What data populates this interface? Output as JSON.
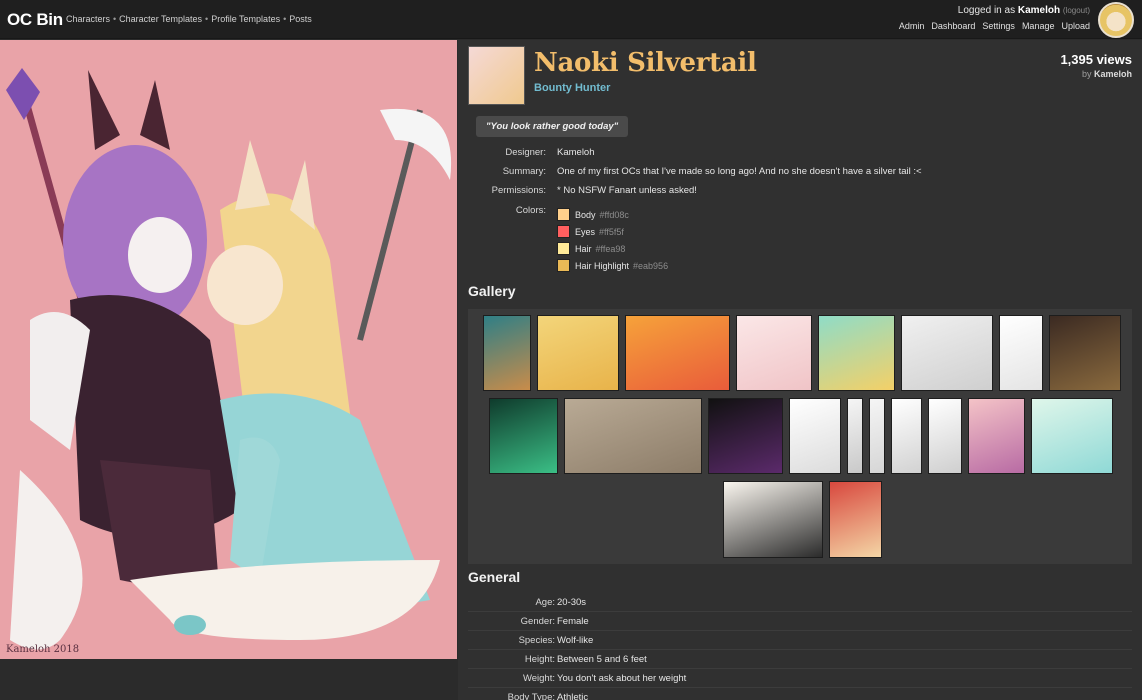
{
  "app": {
    "logo": "OC Bin"
  },
  "topnav": [
    "Characters",
    "Character Templates",
    "Profile Templates",
    "Posts"
  ],
  "user": {
    "logged_prefix": "Logged in as",
    "username": "Kameloh",
    "logout": "(logout)",
    "links": [
      "Admin",
      "Dashboard",
      "Settings",
      "Manage",
      "Upload"
    ]
  },
  "character": {
    "name": "Naoki Silvertail",
    "role": "Bounty Hunter",
    "views": "1,395 views",
    "by_prefix": "by",
    "by_user": "Kameloh",
    "quote": "\"You look rather good today\""
  },
  "info": {
    "designer_label": "Designer:",
    "designer": "Kameloh",
    "summary_label": "Summary:",
    "summary": "One of my first OCs that I've made so long ago! And no she doesn't have a silver tail :<",
    "permissions_label": "Permissions:",
    "permissions": "* No NSFW Fanart unless asked!",
    "colors_label": "Colors:"
  },
  "colors": [
    {
      "name": "Body",
      "hex": "#ffd08c"
    },
    {
      "name": "Eyes",
      "hex": "#ff5f5f"
    },
    {
      "name": "Hair",
      "hex": "#ffea98"
    },
    {
      "name": "Hair Highlight",
      "hex": "#eab956"
    }
  ],
  "sections": {
    "gallery": "Gallery",
    "general": "General"
  },
  "artwork": {
    "signature": "Kameloh 2018"
  },
  "general": [
    {
      "label": "Age:",
      "value": "20-30s"
    },
    {
      "label": "Gender:",
      "value": "Female"
    },
    {
      "label": "Species:",
      "value": "Wolf-like"
    },
    {
      "label": "Height:",
      "value": "Between 5 and 6 feet"
    },
    {
      "label": "Weight:",
      "value": "You don't ask about her weight"
    },
    {
      "label": "Body Type:",
      "value": "Athletic"
    }
  ],
  "theme": {
    "accent": "#f2bd6b",
    "role_color": "#72bcd0",
    "background": "#2b2b2b"
  }
}
